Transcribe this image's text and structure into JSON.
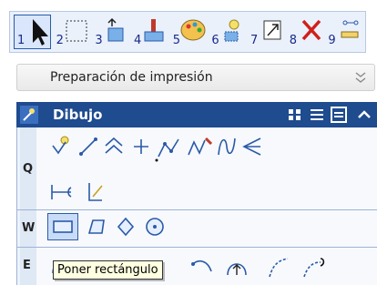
{
  "toolbar": {
    "tools": [
      {
        "num": "1",
        "icon": "select-arrow-icon"
      },
      {
        "num": "2",
        "icon": "selection-rectangle-icon"
      },
      {
        "num": "3",
        "icon": "move-icon"
      },
      {
        "num": "4",
        "icon": "paint-brush-icon"
      },
      {
        "num": "5",
        "icon": "palette-icon"
      },
      {
        "num": "6",
        "icon": "explode-icon"
      },
      {
        "num": "7",
        "icon": "scale-icon"
      },
      {
        "num": "8",
        "icon": "delete-x-icon"
      },
      {
        "num": "9",
        "icon": "measure-icon"
      }
    ]
  },
  "prep": {
    "label": "Preparación de impresión"
  },
  "panel": {
    "title": "Dibujo",
    "rows": [
      {
        "key": "Q"
      },
      {
        "key": "W"
      },
      {
        "key": "E"
      }
    ]
  },
  "tooltip": {
    "text": "Poner rectángulo"
  },
  "colors": {
    "header": "#1f4b8f",
    "accent": "#2b5aa8",
    "tooltip_bg": "#ffffe1"
  }
}
